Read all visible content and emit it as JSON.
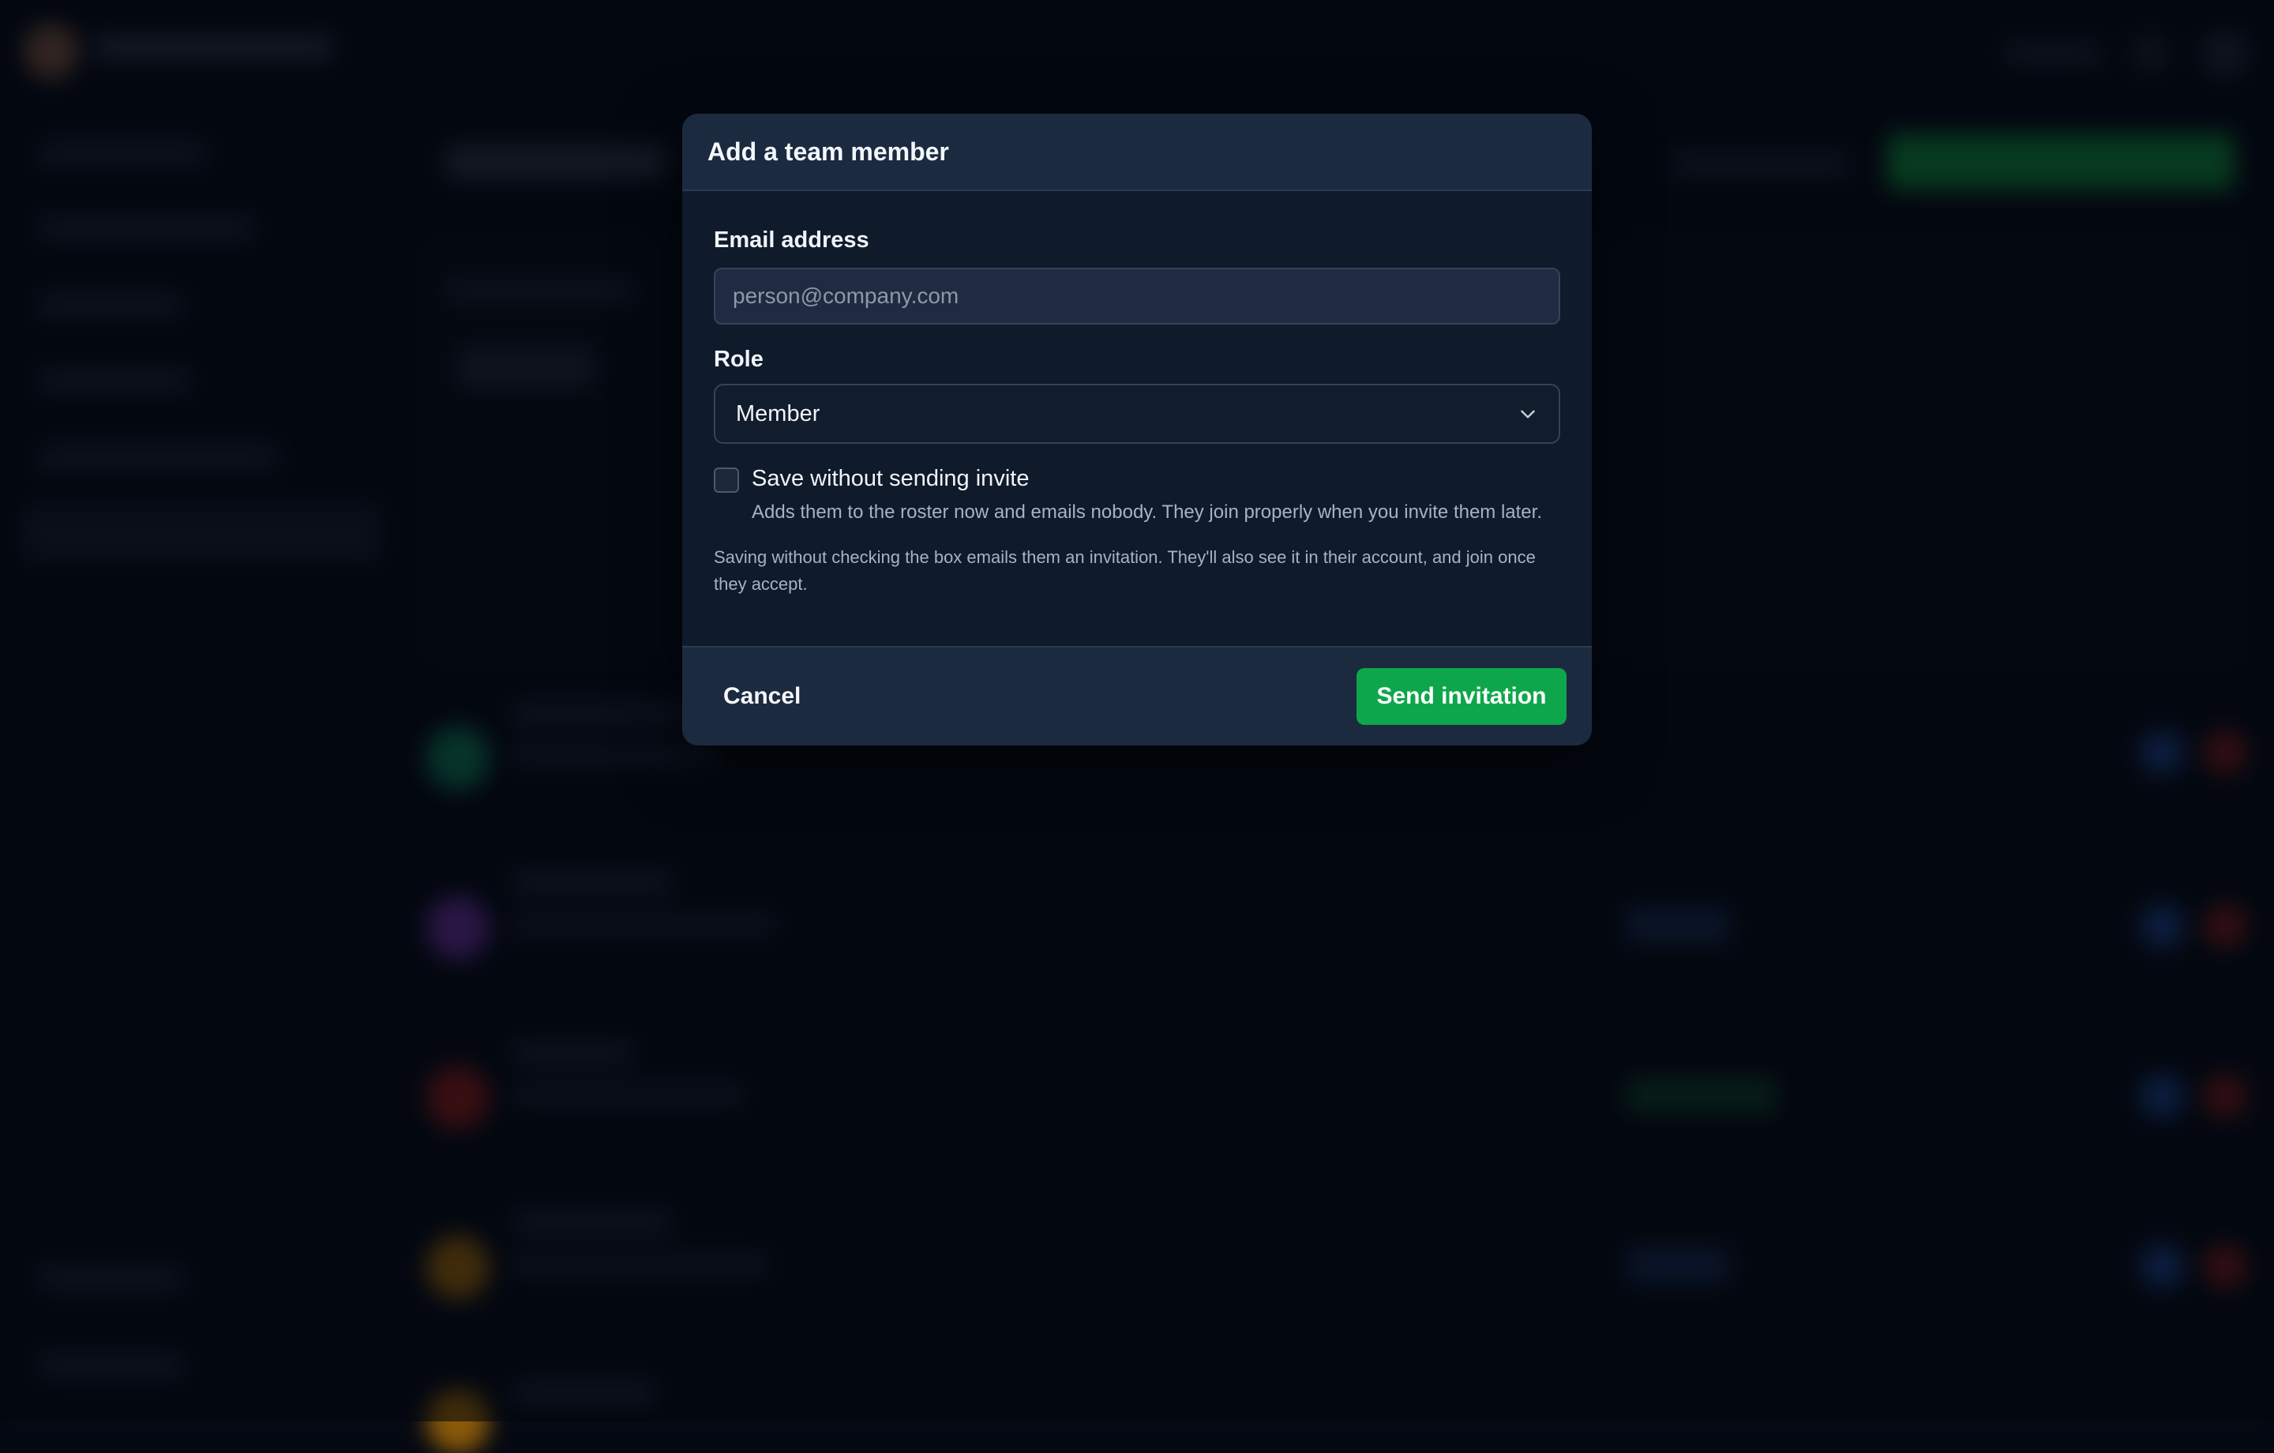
{
  "modal": {
    "title": "Add a team member",
    "email": {
      "label": "Email address",
      "value": "",
      "placeholder": "person@company.com"
    },
    "role": {
      "label": "Role",
      "selected": "Member"
    },
    "skip_invite": {
      "label": "Save without sending invite",
      "checked": false,
      "help": "Adds them to the roster now and emails nobody. They join properly when you invite them later."
    },
    "footnote": "Saving without checking the box emails them an invitation. They'll also see it in their account, and join once they accept.",
    "cancel_label": "Cancel",
    "submit_label": "Send invitation"
  },
  "colors": {
    "accent": "#0ea64a",
    "modal_bg": "#0f1a2b",
    "modal_header_bg": "#1c2a40"
  }
}
